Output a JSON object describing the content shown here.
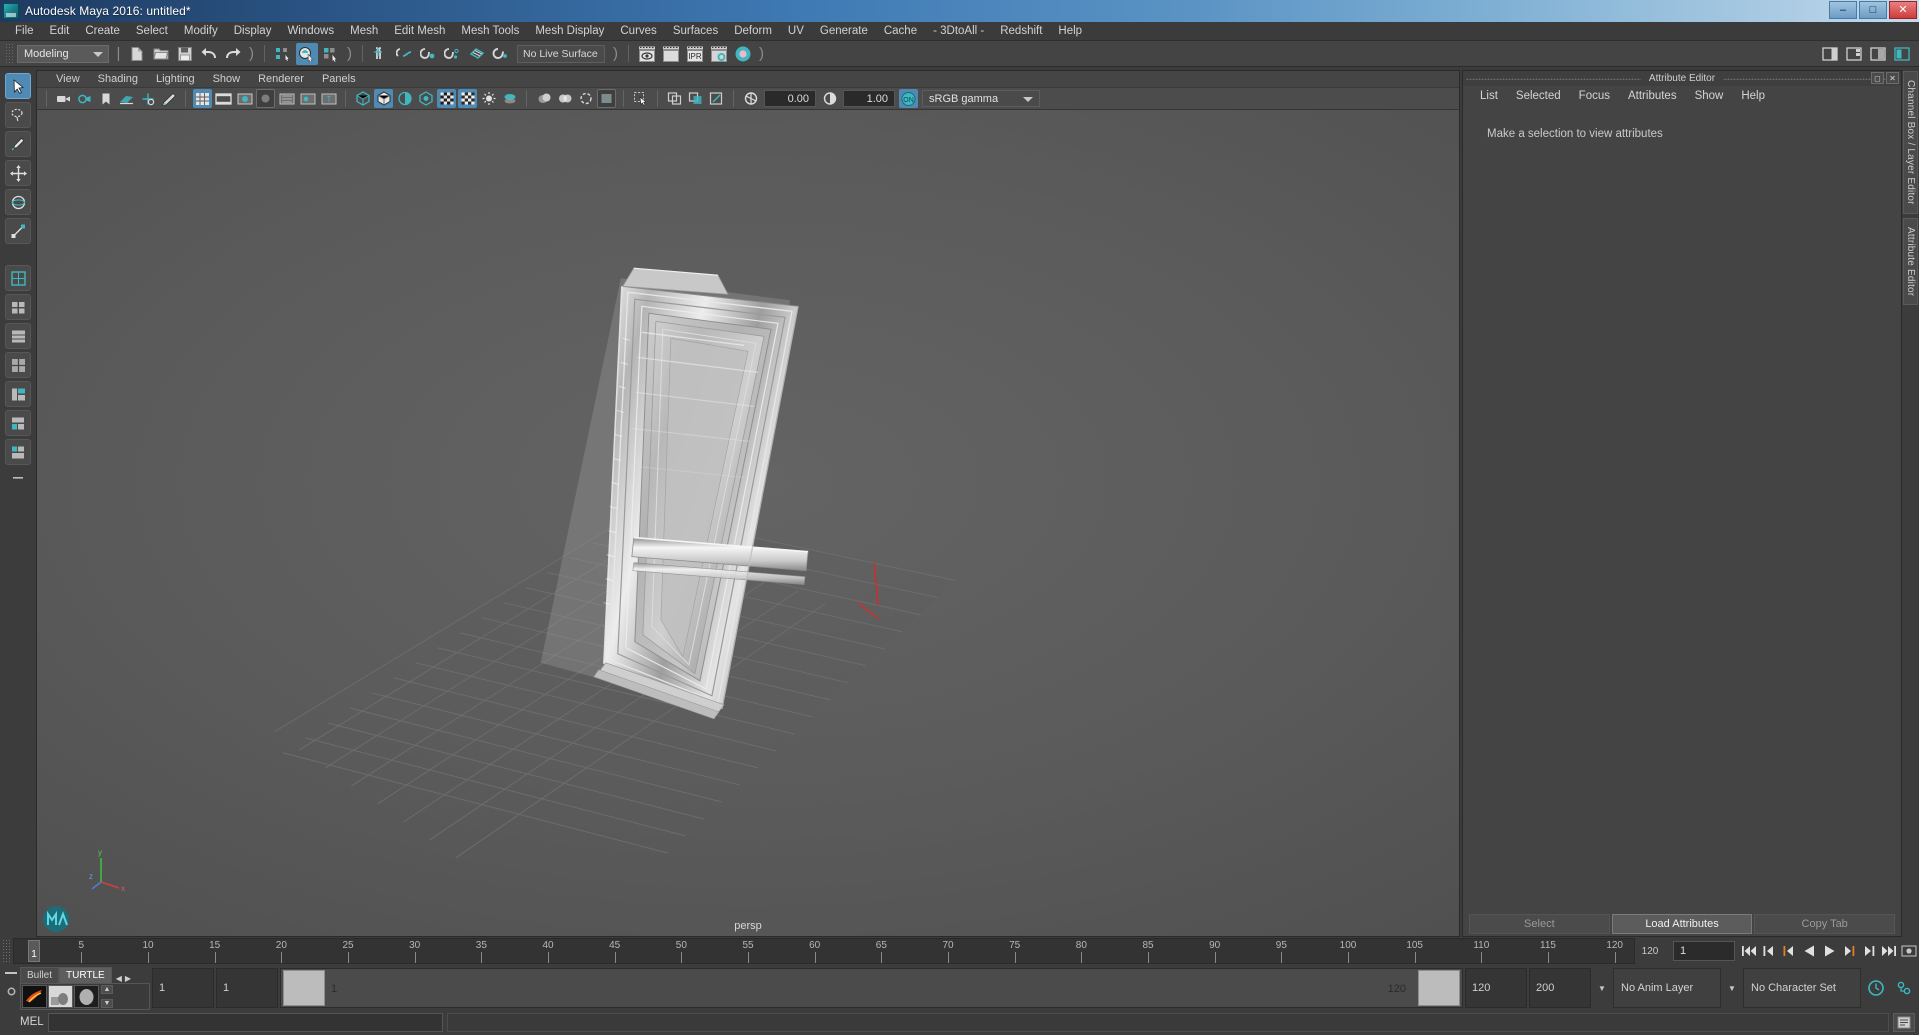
{
  "window": {
    "title": "Autodesk Maya 2016: untitled*",
    "icon": "maya-app-icon",
    "minimize": "–",
    "maximize": "□",
    "close": "✕"
  },
  "menubar": {
    "items": [
      "File",
      "Edit",
      "Create",
      "Select",
      "Modify",
      "Display",
      "Windows",
      "Mesh",
      "Edit Mesh",
      "Mesh Tools",
      "Mesh Display",
      "Curves",
      "Surfaces",
      "Deform",
      "UV",
      "Generate",
      "Cache",
      "- 3DtoAll -",
      "Redshift",
      "Help"
    ]
  },
  "statusbar": {
    "menu_set": "Modeling",
    "live_surface": "No Live Surface",
    "icons": [
      "new-scene-icon",
      "open-scene-icon",
      "save-scene-icon",
      "undo-icon",
      "redo-icon",
      "select-by-hierarchy-icon",
      "select-by-object-icon",
      "select-by-component-icon",
      "snap-to-grid-icon",
      "snap-to-curve-icon",
      "snap-to-point-icon",
      "snap-to-projected-center-icon",
      "snap-to-view-plane-icon",
      "make-live-icon",
      "render-view-icon",
      "render-current-frame-icon",
      "ipr-render-icon",
      "render-settings-icon",
      "hypershade-icon"
    ],
    "ipr_label": "IPR",
    "right_icons": [
      "sidebar-toggle-icon",
      "attribute-editor-toggle-icon",
      "channelbox-toggle-icon",
      "modeling-toolkit-toggle-icon"
    ]
  },
  "toolbox": {
    "items": [
      {
        "name": "select-tool",
        "selected": true
      },
      {
        "name": "lasso-select-tool",
        "selected": false
      },
      {
        "name": "paint-select-tool",
        "selected": false
      },
      {
        "name": "move-tool",
        "selected": false
      },
      {
        "name": "rotate-tool",
        "selected": false
      },
      {
        "name": "scale-tool",
        "selected": false
      },
      {
        "name": "last-tool-used",
        "selected": false
      },
      {
        "name": "layout-single-pane",
        "selected": false
      },
      {
        "name": "layout-two-pane-side",
        "selected": false
      },
      {
        "name": "layout-two-pane-stacked",
        "selected": false
      },
      {
        "name": "layout-four-pane",
        "selected": false
      },
      {
        "name": "layout-hypergraph",
        "selected": false
      },
      {
        "name": "layout-persp-outliner",
        "selected": false
      },
      {
        "name": "layout-persp-graph",
        "selected": false
      },
      {
        "name": "layout-more",
        "selected": false
      }
    ]
  },
  "viewport_panel": {
    "menus": [
      "View",
      "Shading",
      "Lighting",
      "Show",
      "Renderer",
      "Panels"
    ],
    "toolbar": {
      "exposure_value": "0.00",
      "gamma_value": "1.00",
      "color_management": "sRGB gamma",
      "icons": [
        "select-camera-icon",
        "camera-attributes-icon",
        "bookmarks-icon",
        "image-plane-icon",
        "two-d-pan-zoom-icon",
        "grease-pencil-icon",
        "grid-toggle-icon",
        "film-gate-icon",
        "resolution-gate-icon",
        "gate-mask-icon",
        "field-chart-icon",
        "safe-action-icon",
        "safe-title-icon",
        "wireframe-shading-icon",
        "smooth-shade-all-icon",
        "smooth-shade-selected-icon",
        "flat-shade-icon",
        "shaded-wireframe-icon",
        "textured-icon",
        "use-default-light-icon",
        "shadows-icon",
        "screen-space-ao-icon",
        "motion-blur-icon",
        "multisample-aa-icon",
        "depth-of-field-icon",
        "isolate-select-icon",
        "xray-icon",
        "xray-joints-icon",
        "xray-active-components-icon",
        "exposure-icon",
        "gamma-icon",
        "color-management-toggle-icon"
      ]
    },
    "camera_label": "persp",
    "axis_labels": {
      "x": "x",
      "y": "y",
      "z": "z"
    }
  },
  "attribute_editor": {
    "title": "Attribute Editor",
    "window_buttons": [
      "undock-icon",
      "close-icon"
    ],
    "menus": [
      "List",
      "Selected",
      "Focus",
      "Attributes",
      "Show",
      "Help"
    ],
    "message": "Make a selection to view attributes",
    "footer_buttons": [
      {
        "label": "Select",
        "enabled": false
      },
      {
        "label": "Load Attributes",
        "enabled": true
      },
      {
        "label": "Copy Tab",
        "enabled": false
      }
    ]
  },
  "right_tabs": [
    "Channel Box / Layer Editor",
    "Attribute Editor"
  ],
  "timeline": {
    "tick_labels": [
      "5",
      "10",
      "15",
      "20",
      "25",
      "30",
      "35",
      "40",
      "45",
      "50",
      "55",
      "60",
      "65",
      "70",
      "75",
      "80",
      "85",
      "90",
      "95",
      "100",
      "105",
      "110",
      "115",
      "120"
    ],
    "tick_values": [
      5,
      10,
      15,
      20,
      25,
      30,
      35,
      40,
      45,
      50,
      55,
      60,
      65,
      70,
      75,
      80,
      85,
      90,
      95,
      100,
      105,
      110,
      115,
      120
    ],
    "start": 1,
    "end": 120,
    "current_frame": "1",
    "current_frame_field": "1",
    "playback_buttons": [
      "go-to-start-icon",
      "step-back-frame-icon",
      "step-back-key-icon",
      "play-backwards-icon",
      "play-forwards-icon",
      "step-forward-key-icon",
      "step-forward-frame-icon",
      "go-to-end-icon"
    ]
  },
  "range_slider": {
    "anim_start": "1",
    "anim_end": "1",
    "range_start_label": "1",
    "range_end_label": "120",
    "playback_end": "120",
    "anim_total_end": "200",
    "anim_layer": "No Anim Layer",
    "character_set": "No Character Set",
    "icons": [
      "auto-keyframe-icon",
      "animation-preferences-icon"
    ]
  },
  "shelf": {
    "tabs": [
      "Bullet",
      "TURTLE"
    ],
    "active_tab": "TURTLE",
    "nav_prev": "◀",
    "nav_next": "▶",
    "icons": [
      "turtle-render-icon",
      "turtle-bake-icon",
      "turtle-sphere-icon"
    ]
  },
  "command_line": {
    "language_label": "MEL",
    "input_value": "",
    "output_value": "",
    "script-editor-icon": "script-editor-icon"
  },
  "colors": {
    "accent_blue": "#4f8ab4",
    "titlebar_blue": "#2b5687",
    "panel_bg": "#444444",
    "viewport_bg": "#5b5b5b",
    "teal_icon": "#3fb6c0",
    "orange_marker": "#e08020"
  }
}
